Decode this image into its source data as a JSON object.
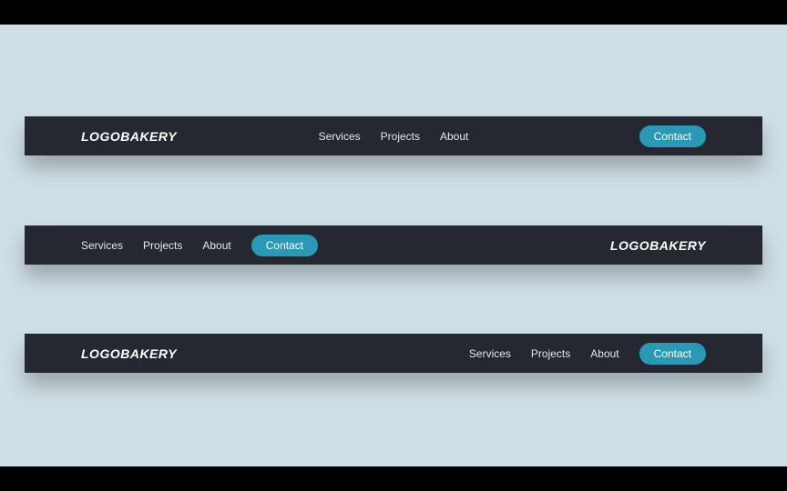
{
  "brand": "LOGOBAKERY",
  "nav": {
    "services": "Services",
    "projects": "Projects",
    "about": "About",
    "contact": "Contact"
  },
  "colors": {
    "bar_bg": "#252830",
    "page_bg": "#cfdfe6",
    "accent": "#2a99b6"
  }
}
